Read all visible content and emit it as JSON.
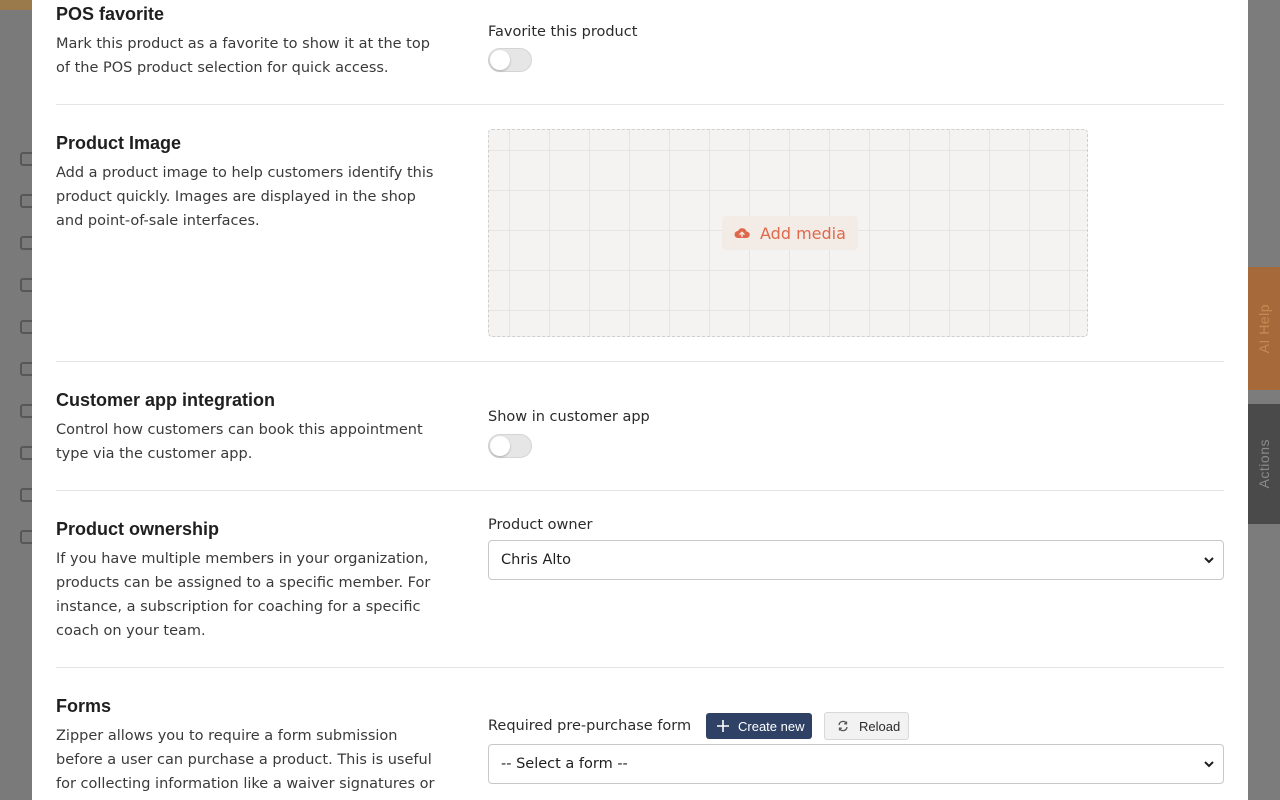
{
  "background_app": {
    "right_tabs": {
      "ai_help": "AI Help",
      "actions": "Actions"
    }
  },
  "modal": {
    "pos_favorite": {
      "title": "POS favorite",
      "description": "Mark this product as a favorite to show it at the top of the POS product selection for quick access.",
      "field_label": "Favorite this product",
      "toggle_on": false
    },
    "product_image": {
      "title": "Product Image",
      "description": "Add a product image to help customers identify this product quickly. Images are displayed in the shop and point-of-sale interfaces.",
      "add_media_label": "Add media",
      "add_media_icon": "cloud-upload-icon"
    },
    "customer_app": {
      "title": "Customer app integration",
      "description": "Control how customers can book this appointment type via the customer app.",
      "field_label": "Show in customer app",
      "toggle_on": false
    },
    "ownership": {
      "title": "Product ownership",
      "description": "If you have multiple members in your organization, products can be assigned to a specific member. For instance, a subscription for coaching for a specific coach on your team.",
      "field_label": "Product owner",
      "selected": "Chris Alto"
    },
    "forms": {
      "title": "Forms",
      "description": "Zipper allows you to require a form submission before a user can purchase a product. This is useful for collecting information like a waiver signatures or relevant history.",
      "field_label": "Required pre-purchase form",
      "create_new_label": "Create new",
      "reload_label": "Reload",
      "selected": "-- Select a form --"
    }
  },
  "colors": {
    "accent": "#e0684a",
    "primary_button": "#2f4266",
    "ai_help_tab": "#a66a3a"
  }
}
